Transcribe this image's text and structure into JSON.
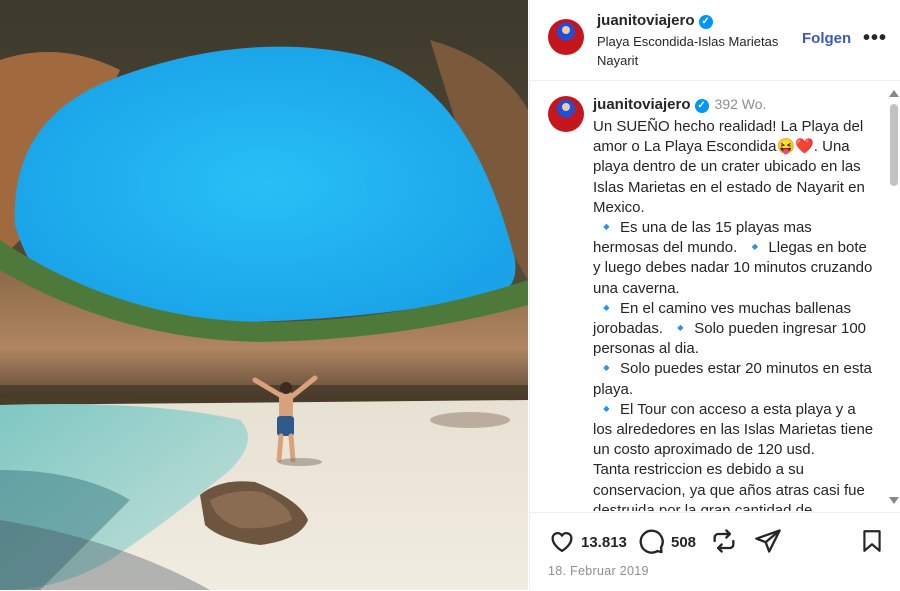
{
  "post": {
    "author": {
      "username": "juanitoviajero",
      "verified_glyph": "✓"
    },
    "location_line1": "Playa Escondida-Islas Marietas",
    "location_line2": "Nayarit",
    "follow_label": "Folgen",
    "more_icon": "•••",
    "caption": {
      "age": "392 Wo.",
      "text": "Un SUEÑO hecho realidad! La Playa del amor o La Playa Escondida😝❤️. Una playa dentro de un crater ubicado en las Islas Marietas en el estado de Nayarit en Mexico.\n 🔹 Es una de las 15 playas mas hermosas del mundo.  🔹 Llegas en bote y luego debes nadar 10 minutos cruzando una caverna.\n 🔹 En el camino ves muchas ballenas jorobadas.  🔹 Solo pueden ingresar 100 personas al dia.\n 🔹 Solo puedes estar 20 minutos en esta playa.\n 🔹 El Tour con acceso a esta playa y a los alrededores en las Islas Marietas tiene un costo aproximado de 120 usd.\nTanta restriccion es debido a su conservacion, ya que años atras casi fue destruida por la gran cantidad de"
    },
    "likes": "13.813",
    "comments": "508",
    "date": "18. Februar 2019"
  },
  "icons": {
    "like": "heart-icon",
    "comment": "comment-icon",
    "repost": "repost-icon",
    "share": "send-icon",
    "save": "bookmark-icon"
  },
  "colors": {
    "follow": "#3b5ab5",
    "verified": "#0095f6",
    "sky": "#27b2ef"
  }
}
